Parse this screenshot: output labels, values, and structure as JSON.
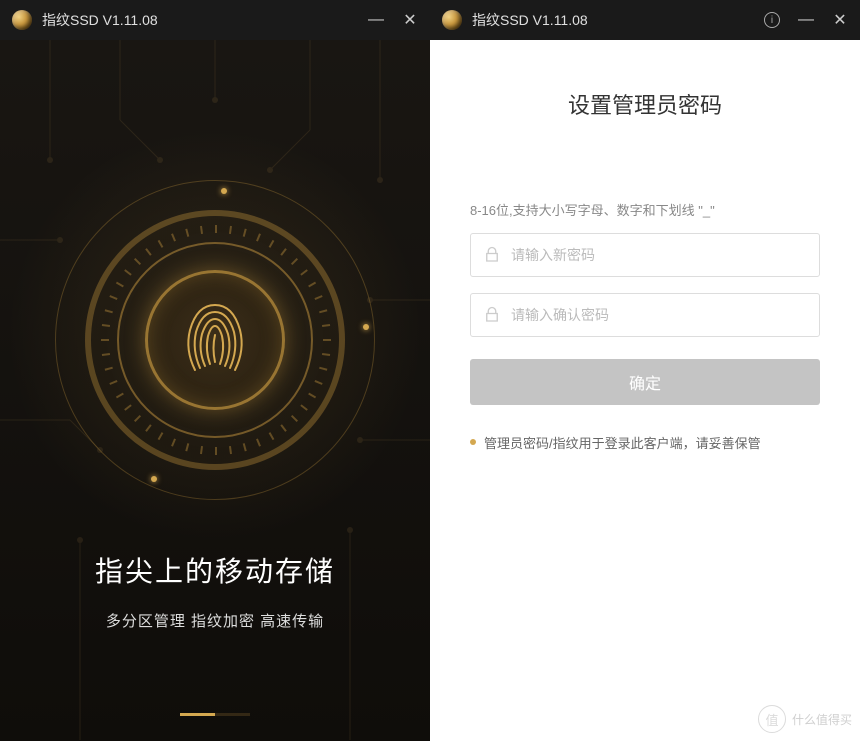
{
  "left": {
    "title": "指纹SSD V1.11.08",
    "splash_title": "指尖上的移动存储",
    "splash_subtitle": "多分区管理 指纹加密 高速传输"
  },
  "right": {
    "title": "指纹SSD V1.11.08",
    "form_title": "设置管理员密码",
    "hint": "8-16位,支持大小写字母、数字和下划线 \"_\"",
    "password_placeholder": "请输入新密码",
    "confirm_placeholder": "请输入确认密码",
    "submit_label": "确定",
    "note": "管理员密码/指纹用于登录此客户端，请妥善保管"
  },
  "watermark": {
    "badge": "值",
    "text": "什么值得买"
  }
}
